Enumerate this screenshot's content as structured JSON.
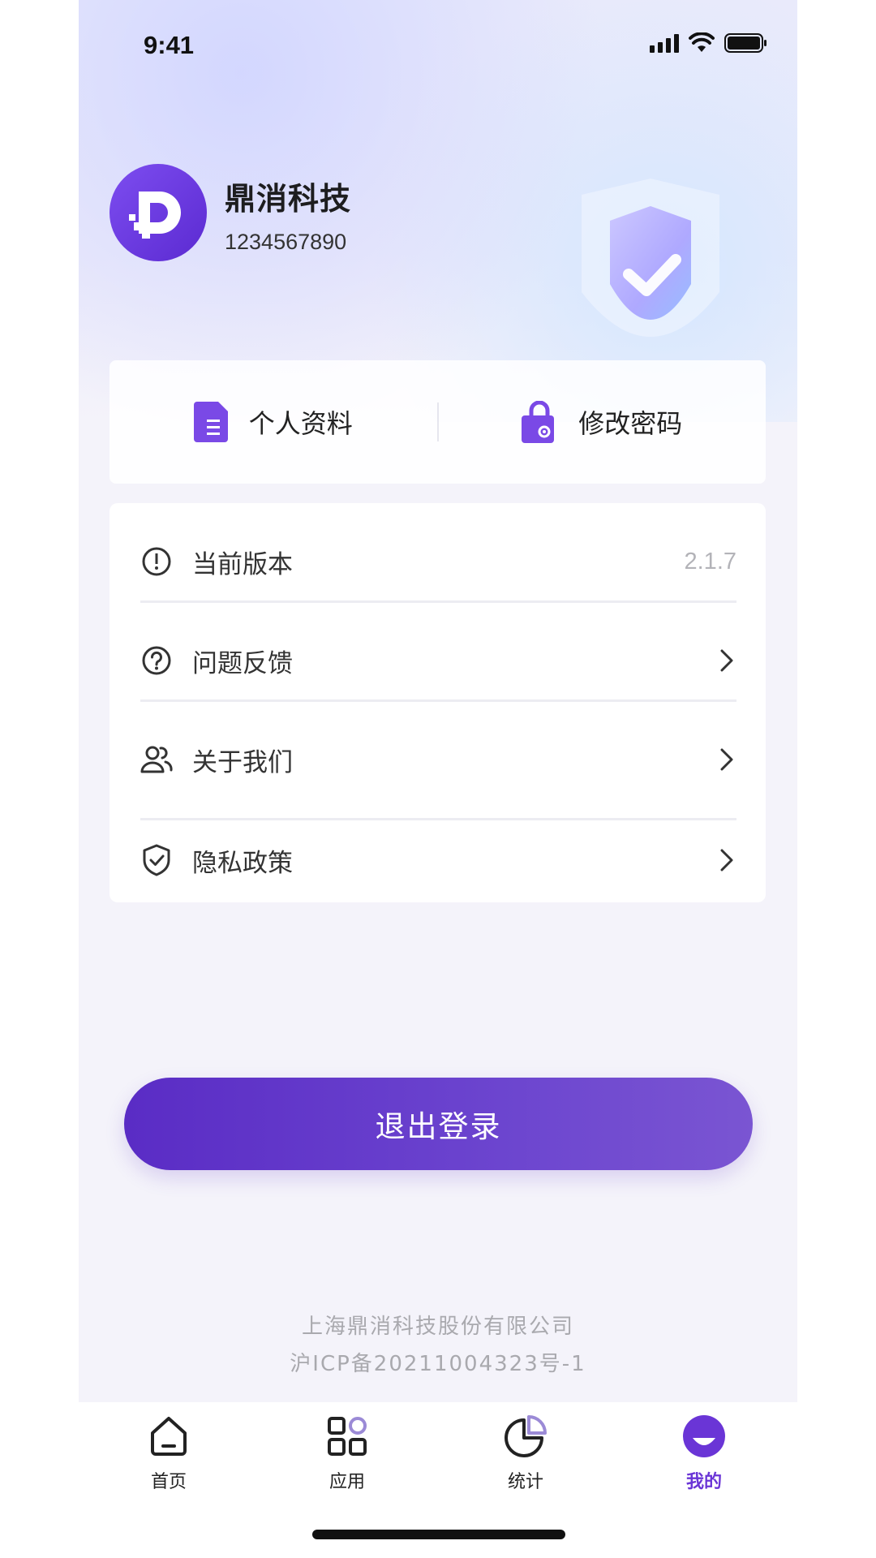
{
  "status_bar": {
    "time": "9:41"
  },
  "profile": {
    "name": "鼎消科技",
    "id": "1234567890"
  },
  "quick_actions": [
    {
      "label": "个人资料",
      "icon": "document-icon"
    },
    {
      "label": "修改密码",
      "icon": "lock-gear-icon"
    }
  ],
  "menu": {
    "version": {
      "label": "当前版本",
      "value": "2.1.7",
      "icon": "info-circle-icon"
    },
    "feedback": {
      "label": "问题反馈",
      "icon": "question-circle-icon"
    },
    "about": {
      "label": "关于我们",
      "icon": "users-icon"
    },
    "privacy": {
      "label": "隐私政策",
      "icon": "shield-check-icon"
    }
  },
  "logout": {
    "label": "退出登录"
  },
  "footer": {
    "company": "上海鼎消科技股份有限公司",
    "icp": "沪ICP备20211004323号-1"
  },
  "tab_bar": {
    "tabs": [
      {
        "label": "首页",
        "icon": "home-icon",
        "active": false
      },
      {
        "label": "应用",
        "icon": "apps-icon",
        "active": false
      },
      {
        "label": "统计",
        "icon": "pie-chart-icon",
        "active": false
      },
      {
        "label": "我的",
        "icon": "profile-icon",
        "active": true
      }
    ]
  },
  "colors": {
    "accent": "#6a35d6",
    "button_start": "#5a2cc5",
    "button_end": "#7a55d2",
    "background": "#f4f3fa"
  }
}
